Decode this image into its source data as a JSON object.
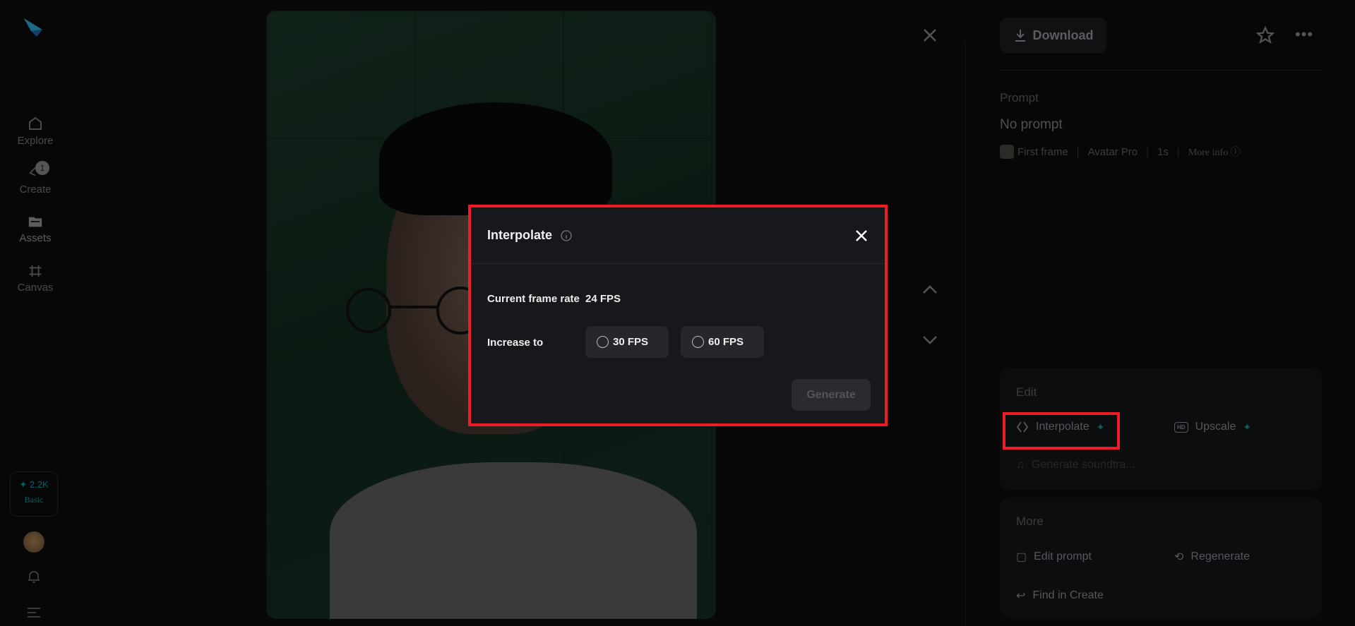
{
  "sidebar": {
    "items": [
      {
        "label": "Explore"
      },
      {
        "label": "Create",
        "badge": "1"
      },
      {
        "label": "Assets"
      },
      {
        "label": "Canvas"
      }
    ],
    "credits": "2.2K",
    "plan": "Basic"
  },
  "panel": {
    "download": "Download",
    "prompt_label": "Prompt",
    "prompt": "No prompt",
    "meta": {
      "first_frame": "First frame",
      "model": "Avatar Pro",
      "duration": "1s",
      "more_info": "More info"
    },
    "edit": {
      "title": "Edit",
      "interpolate": "Interpolate",
      "upscale": "Upscale",
      "soundtrack": "Generate soundtra..."
    },
    "more": {
      "title": "More",
      "edit_prompt": "Edit prompt",
      "regenerate": "Regenerate",
      "find": "Find in Create"
    }
  },
  "dialog": {
    "title": "Interpolate",
    "current_label": "Current frame rate",
    "current_value": "24 FPS",
    "increase_label": "Increase to",
    "options": [
      "30 FPS",
      "60 FPS"
    ],
    "generate": "Generate"
  },
  "colors": {
    "accent": "#0e5f62",
    "highlight": "#ee1c25"
  }
}
